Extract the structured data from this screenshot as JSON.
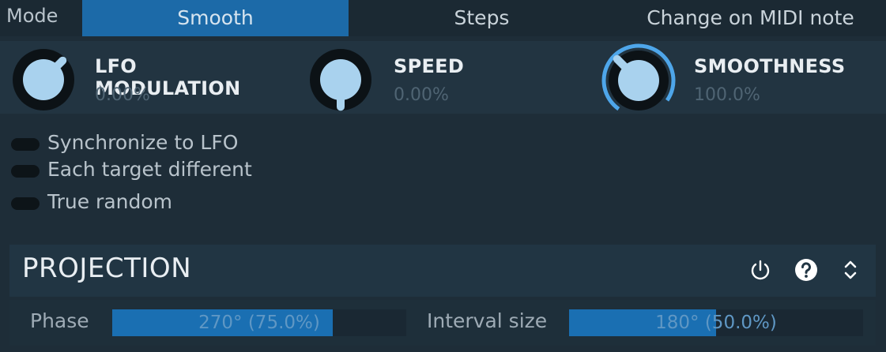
{
  "mode": {
    "label": "Mode",
    "options": [
      {
        "label": "Smooth",
        "selected": true
      },
      {
        "label": "Steps",
        "selected": false
      },
      {
        "label": "Change on MIDI note",
        "selected": false
      }
    ]
  },
  "knobs": [
    {
      "title": "LFO MODULATION",
      "value": "0.00%",
      "level": 0.0
    },
    {
      "title": "SPEED",
      "value": "0.00%",
      "level": 0.5
    },
    {
      "title": "SMOOTHNESS",
      "value": "100.0%",
      "level": 1.0
    }
  ],
  "toggles": [
    {
      "label": "Synchronize to LFO",
      "on": false
    },
    {
      "label": "Each target different",
      "on": false
    },
    {
      "label": "True random",
      "on": false
    }
  ],
  "projection": {
    "title": "PROJECTION",
    "icons": [
      "power-icon",
      "help-icon",
      "expand-collapse-icon"
    ],
    "phase": {
      "label": "Phase",
      "value": "270° (75.0%)",
      "fraction": 0.75
    },
    "interval": {
      "label": "Interval size",
      "value": "180° (50.0%)",
      "fraction": 0.5
    }
  },
  "colors": {
    "accent": "#1c6aa8",
    "knob_ring": "#4ea6ea",
    "background": "#1e2d38"
  }
}
